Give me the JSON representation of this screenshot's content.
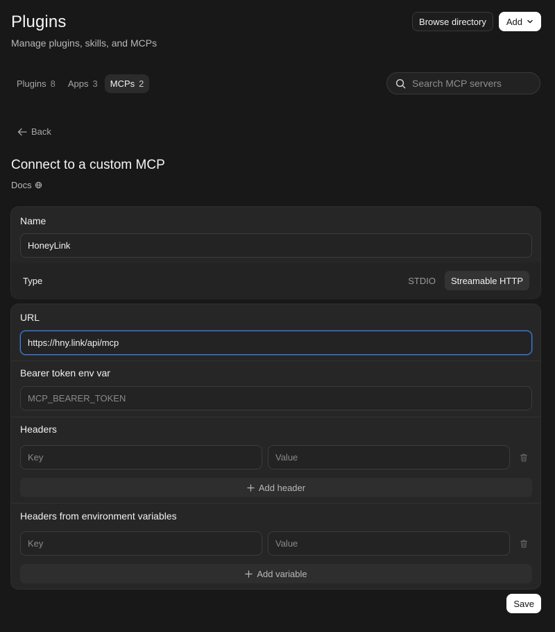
{
  "header": {
    "title": "Plugins",
    "subtitle": "Manage plugins, skills, and MCPs",
    "browse_label": "Browse directory",
    "add_label": "Add"
  },
  "tabs": [
    {
      "label": "Plugins",
      "count": "8",
      "active": false
    },
    {
      "label": "Apps",
      "count": "3",
      "active": false
    },
    {
      "label": "MCPs",
      "count": "2",
      "active": true
    }
  ],
  "search": {
    "placeholder": "Search MCP servers",
    "value": ""
  },
  "back_label": "Back",
  "section": {
    "title": "Connect to a custom MCP",
    "docs_label": "Docs"
  },
  "form": {
    "name": {
      "label": "Name",
      "value": "HoneyLink"
    },
    "type": {
      "label": "Type",
      "options": [
        "STDIO",
        "Streamable HTTP"
      ],
      "selected": "Streamable HTTP"
    },
    "url": {
      "label": "URL",
      "value": "https://hny.link/api/mcp"
    },
    "bearer": {
      "label": "Bearer token env var",
      "value": "",
      "placeholder": "MCP_BEARER_TOKEN"
    },
    "headers": {
      "label": "Headers",
      "key_placeholder": "Key",
      "value_placeholder": "Value",
      "add_label": "Add header"
    },
    "env_headers": {
      "label": "Headers from environment variables",
      "key_placeholder": "Key",
      "value_placeholder": "Value",
      "add_label": "Add variable"
    },
    "save_label": "Save"
  },
  "colors": {
    "background": "#181818",
    "card": "#262626",
    "focus": "#3f7fe0",
    "primary_button": "#ffffff"
  }
}
